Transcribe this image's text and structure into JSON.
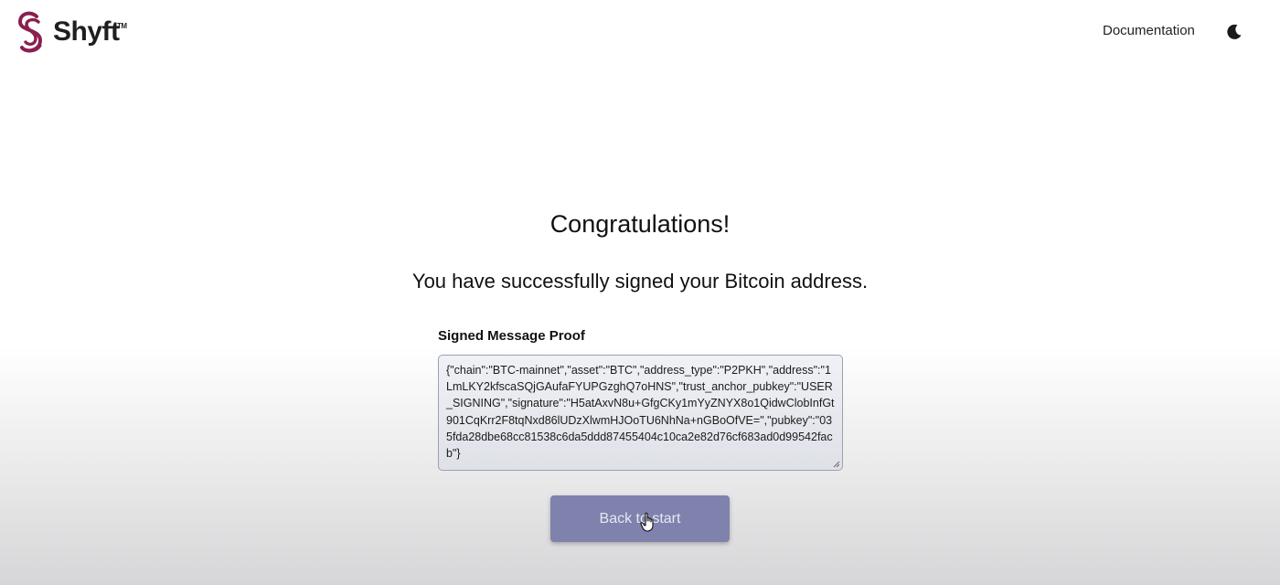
{
  "header": {
    "logo_text": "Shyft",
    "logo_tm": "TM",
    "nav": {
      "documentation_label": "Documentation"
    },
    "theme_icon": "moon-icon"
  },
  "main": {
    "title": "Congratulations!",
    "subtitle": "You have successfully signed your Bitcoin address.",
    "proof": {
      "label": "Signed Message Proof",
      "value": "{\"chain\":\"BTC-mainnet\",\"asset\":\"BTC\",\"address_type\":\"P2PKH\",\"address\":\"1LmLKY2kfscaSQjGAufaFYUPGzghQ7oHNS\",\"trust_anchor_pubkey\":\"USER_SIGNING\",\"signature\":\"H5atAxvN8u+GfgCKy1mYyZNYX8o1QidwClobInfGt901CqKrr2F8tqNxd86lUDzXlwmHJOoTU6NhNa+nGBoOfVE=\",\"pubkey\":\"035fda28dbe68cc81538c6da5ddd87455404c10ca2e82d76cf683ad0d99542facb\"}"
    },
    "back_button_label": "Back to start"
  },
  "colors": {
    "brand": "#8b1e4f",
    "button": "#7f82ad",
    "button_text": "#e7e8f2"
  }
}
